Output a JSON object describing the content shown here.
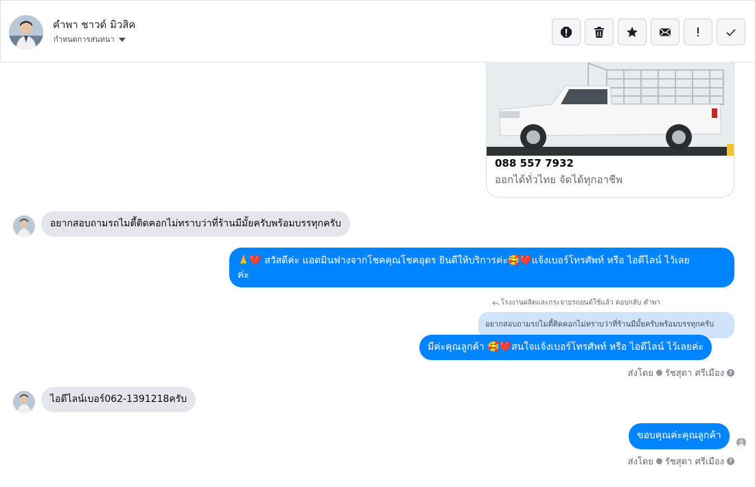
{
  "header": {
    "contact_name": "คำพา ชาวด์ มิวสิค",
    "subtitle": "กำหนดการสนทนา",
    "actions": [
      {
        "name": "report-icon",
        "label": "!"
      },
      {
        "name": "trash-icon"
      },
      {
        "name": "star-icon"
      },
      {
        "name": "envelope-icon"
      },
      {
        "name": "exclamation-icon",
        "label": "!"
      },
      {
        "name": "checkmark-icon"
      }
    ]
  },
  "card": {
    "title": "088 557 7932",
    "subtitle": "ออกได้ทั่วไทย จัดได้ทุกอาชีพ"
  },
  "messages": {
    "m1": "อยากสอบถามรถไมตี้ติดคอกไม่ทราบว่าที่ร้านมีมั้ยครับพร้อมบรรทุกครับ",
    "m2_line1": "🙏❤️ สวัสดีค่ะ แอดมินฟางจากโชคคุณโชคอุดร ยินดีให้บริการค่ะ🥰❤️แจ้งเบอร์โทรศัพท์ หรือ ไอดีไลน์  ไว้เลย",
    "m2_line2": "ค่ะ",
    "reply_note": "โรงงานผลิตและกระจายรถยนต์ใช้แล้ว ตอบกลับ คำพา",
    "quoted": "อยากสอบถามรถไมตี้ติดคอกไม่ทราบว่าที่ร้านมีมั้ยครับพร้อมบรรทุกครับ",
    "m3": "มีค่ะคุณลูกค้า 🥰❤️สนใจแจ้งเบอร์โทรศัพท์ หรือ ไอดีไลน์  ไว้เลยค่ะ",
    "sent_by_label": "ส่งโดย",
    "sent_by_name": "รัชสุดา ศรีเมือง",
    "m4": "ไอดีไลน์เบอร์062-1391218ครับ",
    "m5": "ขอบคุณค่ะคุณลูกค้า",
    "sent_by_label_2": "ส่งโดย",
    "sent_by_name_2": "รัชสุดา ศรีเมือง",
    "help": "?"
  },
  "colors": {
    "outgoing": "#0084ff",
    "incoming": "#e4e6eb",
    "quoted": "#cfe3fb"
  }
}
